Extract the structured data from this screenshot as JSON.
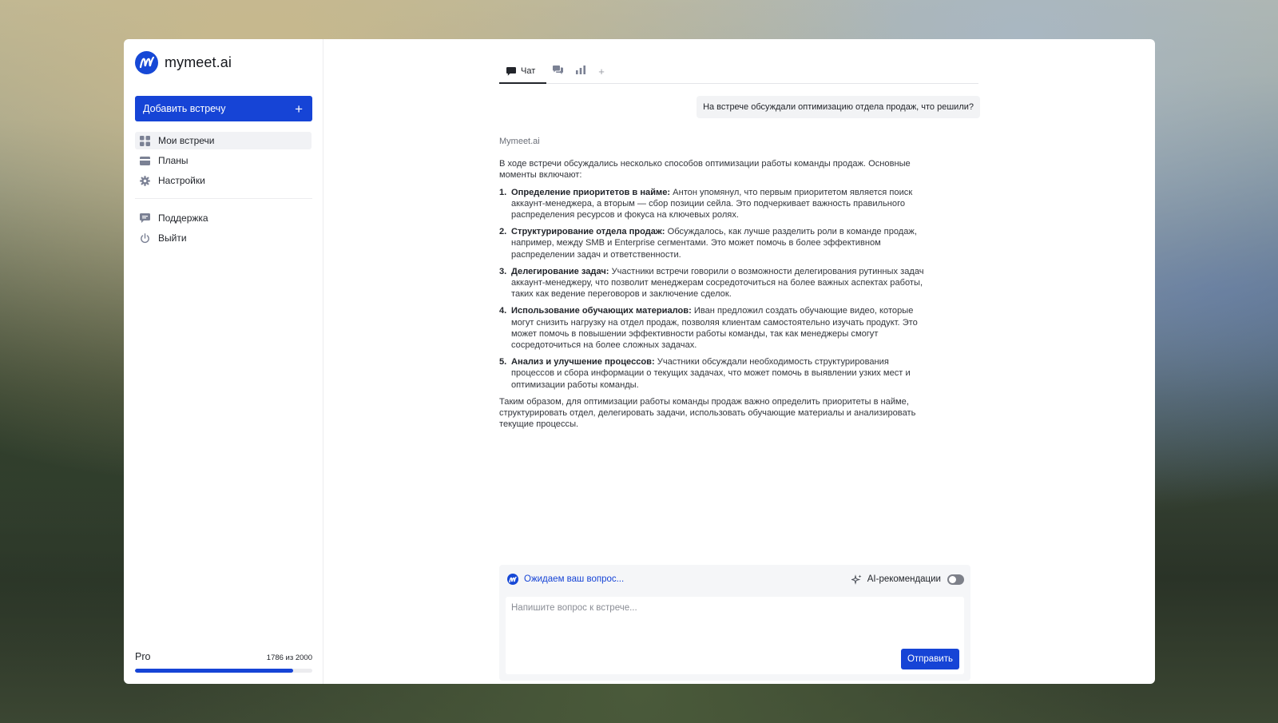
{
  "app": {
    "name": "mymeet.ai",
    "accent": "#1644d6"
  },
  "sidebar": {
    "add_meeting": "Добавить встречу",
    "add_icon": "plus-icon",
    "items": [
      {
        "label": "Мои встречи",
        "icon": "grid-icon",
        "active": true
      },
      {
        "label": "Планы",
        "icon": "card-icon",
        "active": false
      },
      {
        "label": "Настройки",
        "icon": "gear-icon",
        "active": false
      }
    ],
    "secondary": [
      {
        "label": "Поддержка",
        "icon": "chat-bubble-icon"
      },
      {
        "label": "Выйти",
        "icon": "power-icon"
      }
    ],
    "plan": {
      "name": "Pro",
      "usage_text": "1786 из 2000",
      "used": 1786,
      "total": 2000
    }
  },
  "tabs": [
    {
      "label": "Чат",
      "icon": "chat-icon",
      "active": true
    },
    {
      "label": "",
      "icon": "comments-icon",
      "active": false
    },
    {
      "label": "",
      "icon": "bar-chart-icon",
      "active": false
    },
    {
      "label": "+",
      "icon": "plus-icon",
      "active": false
    }
  ],
  "chat": {
    "user_message": "На встрече обсуждали оптимизацию отдела продаж, что решили?",
    "assistant_name": "Mymeet.ai",
    "intro": "В ходе встречи обсуждались несколько способов оптимизации работы команды продаж. Основные моменты включают:",
    "points": [
      {
        "num": "1.",
        "title": "Определение приоритетов в найме:",
        "text": " Антон упомянул, что первым приоритетом является поиск аккаунт-менеджера, а вторым — сбор позиции сейла. Это подчеркивает важность правильного распределения ресурсов и фокуса на ключевых ролях."
      },
      {
        "num": "2.",
        "title": "Структурирование отдела продаж:",
        "text": " Обсуждалось, как лучше разделить роли в команде продаж, например, между SMB и Enterprise сегментами. Это может помочь в более эффективном распределении задач и ответственности."
      },
      {
        "num": "3.",
        "title": "Делегирование задач:",
        "text": " Участники встречи говорили о возможности делегирования рутинных задач аккаунт-менеджеру, что позволит менеджерам сосредоточиться на более важных аспектах работы, таких как ведение переговоров и заключение сделок."
      },
      {
        "num": "4.",
        "title": "Использование обучающих материалов:",
        "text": " Иван предложил создать обучающие видео, которые могут снизить нагрузку на отдел продаж, позволяя клиентам самостоятельно изучать продукт. Это может помочь в повышении эффективности работы команды, так как менеджеры смогут сосредоточиться на более сложных задачах."
      },
      {
        "num": "5.",
        "title": "Анализ и улучшение процессов:",
        "text": " Участники обсуждали необходимость структурирования процессов и сбора информации о текущих задачах, что может помочь в выявлении узких мест и оптимизации работы команды."
      }
    ],
    "outro": "Таким образом, для оптимизации работы команды продаж важно определить приоритеты в найме, структурировать отдел, делегировать задачи, использовать обучающие материалы и анализировать текущие процессы."
  },
  "composer": {
    "status": "Ожидаем ваш вопрос...",
    "ai_label": "AI-рекомендации",
    "ai_enabled": false,
    "placeholder": "Напишите вопрос к встрече...",
    "value": "",
    "send_label": "Отправить"
  }
}
